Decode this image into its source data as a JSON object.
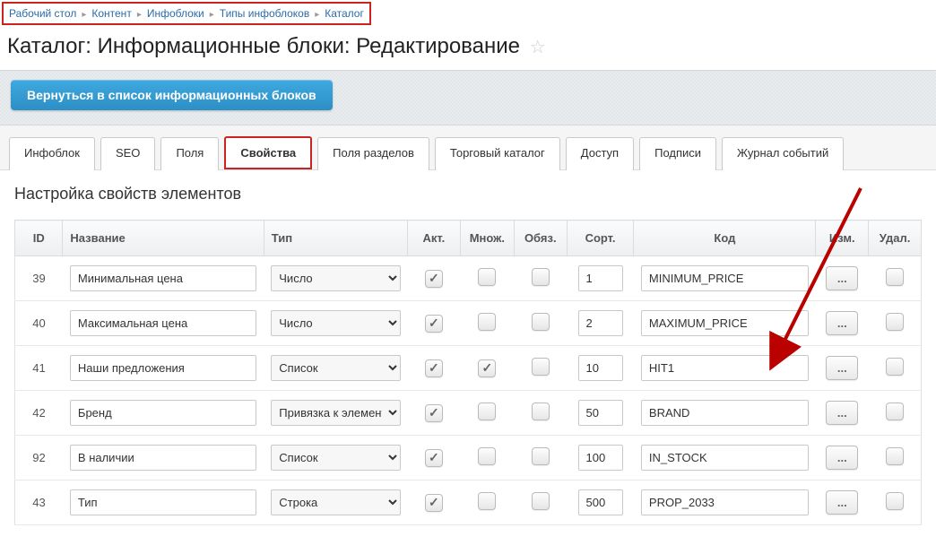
{
  "breadcrumbs": [
    "Рабочий стол",
    "Контент",
    "Инфоблоки",
    "Типы инфоблоков",
    "Каталог"
  ],
  "page_title": "Каталог: Информационные блоки: Редактирование",
  "back_btn": "Вернуться в список информационных блоков",
  "tabs": [
    "Инфоблок",
    "SEO",
    "Поля",
    "Свойства",
    "Поля разделов",
    "Торговый каталог",
    "Доступ",
    "Подписи",
    "Журнал событий"
  ],
  "active_tab_index": 3,
  "section_title": "Настройка свойств элементов",
  "cols": {
    "id": "ID",
    "name": "Название",
    "type": "Тип",
    "act": "Акт.",
    "mult": "Множ.",
    "req": "Обяз.",
    "sort": "Сорт.",
    "code": "Код",
    "edit": "Изм.",
    "del": "Удал."
  },
  "more_label": "...",
  "type_options": [
    "Строка",
    "Число",
    "Список",
    "Привязка к элементам"
  ],
  "rows": [
    {
      "id": "39",
      "name": "Минимальная цена",
      "type": "Число",
      "act": true,
      "mult": false,
      "req": false,
      "sort": "1",
      "code": "MINIMUM_PRICE",
      "del": false
    },
    {
      "id": "40",
      "name": "Максимальная цена",
      "type": "Число",
      "act": true,
      "mult": false,
      "req": false,
      "sort": "2",
      "code": "MAXIMUM_PRICE",
      "del": false
    },
    {
      "id": "41",
      "name": "Наши предложения",
      "type": "Список",
      "act": true,
      "mult": true,
      "req": false,
      "sort": "10",
      "code": "HIT1",
      "del": false
    },
    {
      "id": "42",
      "name": "Бренд",
      "type": "Привязка к элементам",
      "act": true,
      "mult": false,
      "req": false,
      "sort": "50",
      "code": "BRAND",
      "del": false
    },
    {
      "id": "92",
      "name": "В наличии",
      "type": "Список",
      "act": true,
      "mult": false,
      "req": false,
      "sort": "100",
      "code": "IN_STOCK",
      "del": false
    },
    {
      "id": "43",
      "name": "Тип",
      "type": "Строка",
      "act": true,
      "mult": false,
      "req": false,
      "sort": "500",
      "code": "PROP_2033",
      "del": false
    }
  ]
}
